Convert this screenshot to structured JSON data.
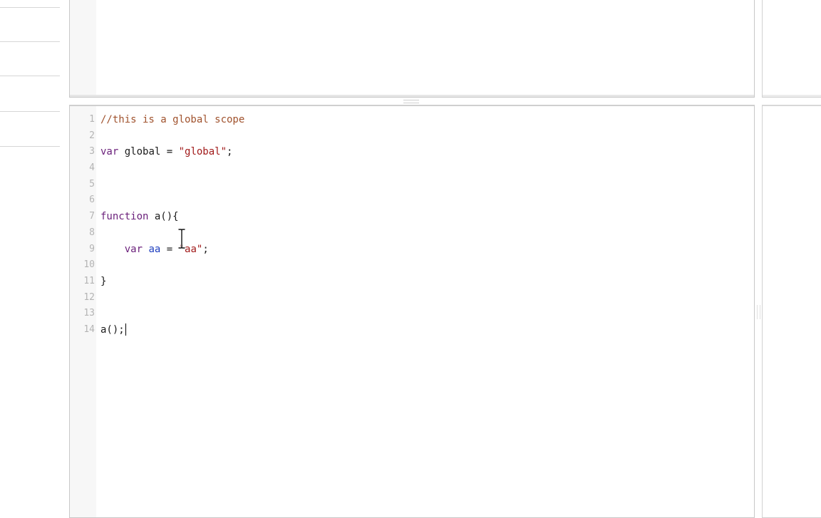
{
  "editor": {
    "lines": [
      {
        "num": "1",
        "tokens": [
          {
            "t": "//this is a global scope",
            "c": "comment"
          }
        ]
      },
      {
        "num": "2",
        "tokens": []
      },
      {
        "num": "3",
        "tokens": [
          {
            "t": "var",
            "c": "keyword"
          },
          {
            "t": " global = ",
            "c": "plain"
          },
          {
            "t": "\"global\"",
            "c": "string"
          },
          {
            "t": ";",
            "c": "plain"
          }
        ]
      },
      {
        "num": "4",
        "tokens": []
      },
      {
        "num": "5",
        "tokens": []
      },
      {
        "num": "6",
        "tokens": []
      },
      {
        "num": "7",
        "tokens": [
          {
            "t": "function",
            "c": "keyword"
          },
          {
            "t": " a(){",
            "c": "plain"
          }
        ]
      },
      {
        "num": "8",
        "tokens": []
      },
      {
        "num": "9",
        "tokens": [
          {
            "t": "    ",
            "c": "plain"
          },
          {
            "t": "var",
            "c": "keyword"
          },
          {
            "t": " ",
            "c": "plain"
          },
          {
            "t": "aa",
            "c": "def"
          },
          {
            "t": " = ",
            "c": "plain"
          },
          {
            "t": "\"aa\"",
            "c": "string"
          },
          {
            "t": ";",
            "c": "plain"
          }
        ]
      },
      {
        "num": "10",
        "tokens": []
      },
      {
        "num": "11",
        "tokens": [
          {
            "t": "}",
            "c": "plain"
          }
        ]
      },
      {
        "num": "12",
        "tokens": []
      },
      {
        "num": "13",
        "tokens": []
      },
      {
        "num": "14",
        "tokens": [
          {
            "t": "a();",
            "c": "plain"
          }
        ],
        "cursor": true
      }
    ]
  },
  "colors": {
    "comment": "#a0522d",
    "keyword": "#6a1f7a",
    "string": "#a11a1a",
    "def": "#1f3fbf",
    "plain": "#1a1a1a",
    "line_number": "#b4b4b4"
  },
  "icons": {
    "mouse_cursor": "ibeam-cursor-icon"
  }
}
